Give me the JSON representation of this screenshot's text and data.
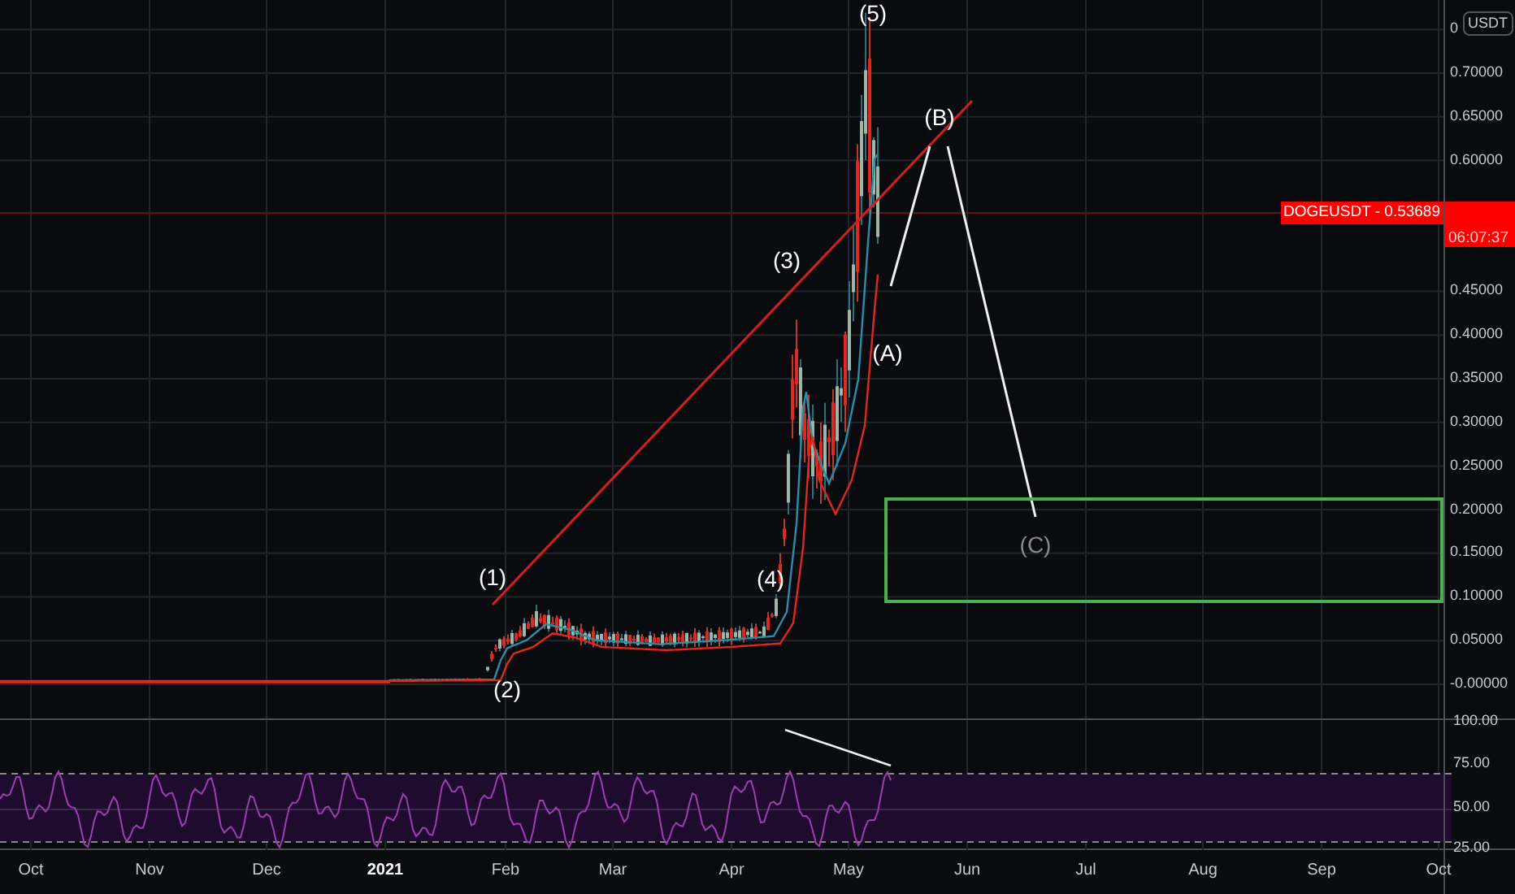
{
  "price_axis": {
    "currency": "USDT",
    "ticks": [
      "0",
      "0.70000",
      "0.65000",
      "0.60000",
      "0.45000",
      "0.40000",
      "0.35000",
      "0.30000",
      "0.25000",
      "0.20000",
      "0.15000",
      "0.10000",
      "0.05000",
      "-0.00000"
    ]
  },
  "last_price": {
    "symbol_price": "DOGEUSDT - 0.53689",
    "countdown": "06:07:37"
  },
  "wave_labels": [
    {
      "text": "(5)",
      "muted": false
    },
    {
      "text": "(B)",
      "muted": false
    },
    {
      "text": "(3)",
      "muted": false
    },
    {
      "text": "(A)",
      "muted": false
    },
    {
      "text": "(1)",
      "muted": false
    },
    {
      "text": "(4)",
      "muted": false
    },
    {
      "text": "(2)",
      "muted": false
    },
    {
      "text": "(C)",
      "muted": true
    }
  ],
  "rsi_axis": {
    "ticks": [
      "100.00",
      "75.00",
      "50.00",
      "25.00"
    ]
  },
  "time_axis": {
    "labels": [
      {
        "text": "Oct",
        "kind": "month"
      },
      {
        "text": "Nov",
        "kind": "month"
      },
      {
        "text": "Dec",
        "kind": "month"
      },
      {
        "text": "2021",
        "kind": "year"
      },
      {
        "text": "Feb",
        "kind": "month"
      },
      {
        "text": "Mar",
        "kind": "month"
      },
      {
        "text": "Apr",
        "kind": "month"
      },
      {
        "text": "May",
        "kind": "month"
      },
      {
        "text": "Jun",
        "kind": "month"
      },
      {
        "text": "Jul",
        "kind": "month"
      },
      {
        "text": "Aug",
        "kind": "month"
      },
      {
        "text": "Sep",
        "kind": "month"
      },
      {
        "text": "Oct",
        "kind": "month"
      }
    ]
  }
}
